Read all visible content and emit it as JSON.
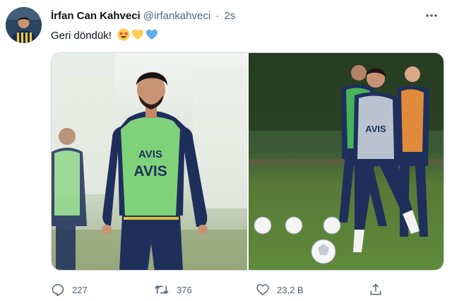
{
  "tweet": {
    "display_name": "İrfan Can Kahveci",
    "handle": "@irfankahveci",
    "separator": "·",
    "time": "2s",
    "text": "Geri döndük!",
    "emojis": [
      "star-struck-face-icon",
      "yellow-heart-icon",
      "blue-heart-icon"
    ],
    "media": [
      {
        "shirt_text": "AVIS",
        "bib_color": "#7fd27a"
      },
      {
        "shirt_text": "AVIS",
        "bib_color": "#b9c3cf"
      }
    ]
  },
  "actions": {
    "reply_count": "227",
    "retweet_count": "376",
    "like_count": "23,2 B"
  },
  "colors": {
    "text_primary": "#0f1419",
    "text_secondary": "#536471",
    "border": "#cfd9de",
    "kit_navy": "#1f2f5c",
    "pitch_green": "#4d7a2a"
  }
}
